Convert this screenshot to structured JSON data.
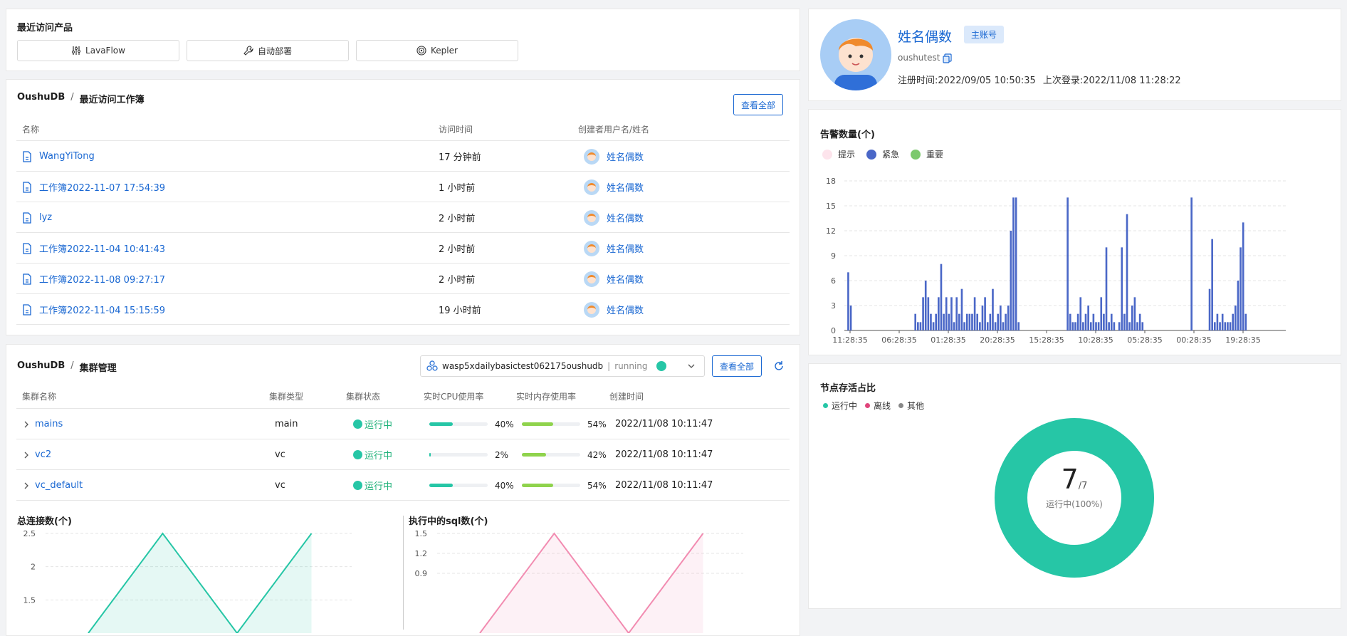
{
  "recent": {
    "title": "最近访问产品",
    "products": [
      {
        "label": "LavaFlow",
        "icon": "sliders-icon"
      },
      {
        "label": "自动部署",
        "icon": "wrench-icon"
      },
      {
        "label": "Kepler",
        "icon": "spiral-icon"
      }
    ]
  },
  "workbooks": {
    "crumb_root": "OushuDB",
    "crumb_sep": "/",
    "crumb_page": "最近访问工作簿",
    "view_all": "查看全部",
    "headers": [
      "名称",
      "访问时间",
      "创建者用户名/姓名"
    ],
    "rows": [
      {
        "name": "WangYiTong",
        "time": "17 分钟前",
        "creator": "姓名偶数"
      },
      {
        "name": "工作簿2022-11-07 17:54:39",
        "time": "1 小时前",
        "creator": "姓名偶数"
      },
      {
        "name": "lyz",
        "time": "2 小时前",
        "creator": "姓名偶数"
      },
      {
        "name": "工作簿2022-11-04 10:41:43",
        "time": "2 小时前",
        "creator": "姓名偶数"
      },
      {
        "name": "工作簿2022-11-08 09:27:17",
        "time": "2 小时前",
        "creator": "姓名偶数"
      },
      {
        "name": "工作簿2022-11-04 15:15:59",
        "time": "19 小时前",
        "creator": "姓名偶数"
      }
    ]
  },
  "cluster": {
    "crumb_root": "OushuDB",
    "crumb_sep": "/",
    "crumb_page": "集群管理",
    "selector_name": "wasp5xdailybasictest062175oushudb",
    "selector_sep": "|",
    "selector_status": "running",
    "view_all": "查看全部",
    "headers": [
      "集群名称",
      "集群类型",
      "集群状态",
      "实时CPU使用率",
      "实时内存使用率",
      "创建时间"
    ],
    "rows": [
      {
        "name": "mains",
        "type": "main",
        "status": "运行中",
        "cpu": 40,
        "cpu_label": "40%",
        "mem": 54,
        "mem_label": "54%",
        "created": "2022/11/08 10:11:47"
      },
      {
        "name": "vc2",
        "type": "vc",
        "status": "运行中",
        "cpu": 2,
        "cpu_label": "2%",
        "mem": 42,
        "mem_label": "42%",
        "created": "2022/11/08 10:11:47"
      },
      {
        "name": "vc_default",
        "type": "vc",
        "status": "运行中",
        "cpu": 40,
        "cpu_label": "40%",
        "mem": 54,
        "mem_label": "54%",
        "created": "2022/11/08 10:11:47"
      }
    ]
  },
  "profile": {
    "name": "姓名偶数",
    "badge": "主账号",
    "username": "oushutest",
    "register": "注册时间:2022/09/05 10:50:35",
    "last_login": "上次登录:2022/11/08 11:28:22"
  },
  "colors": {
    "accent": "#1967d2",
    "teal": "#26c6a6",
    "pink": "#f28cb1",
    "bar_blue": "#4a67c7",
    "green": "#7cc96d"
  },
  "chart_data": [
    {
      "type": "bar",
      "title": "告警数量(个)",
      "legend": [
        {
          "name": "提示",
          "color": "#fde4ec"
        },
        {
          "name": "紧急",
          "color": "#4a67c7"
        },
        {
          "name": "重要",
          "color": "#7cc96d"
        }
      ],
      "yticks": [
        "0",
        "3",
        "6",
        "9",
        "12",
        "15",
        "18"
      ],
      "ylim": [
        0,
        18
      ],
      "xticks": [
        "11:28:35",
        "06:28:35",
        "01:28:35",
        "20:28:35",
        "15:28:35",
        "10:28:35",
        "05:28:35",
        "00:28:35",
        "19:28:35"
      ],
      "series": [
        {
          "name": "紧急",
          "values": [
            0,
            7,
            3,
            0,
            0,
            0,
            0,
            0,
            0,
            0,
            0,
            0,
            0,
            0,
            0,
            0,
            0,
            0,
            0,
            0,
            0,
            0,
            0,
            0,
            0,
            0,
            0,
            2,
            1,
            1,
            4,
            6,
            4,
            2,
            1,
            2,
            4,
            8,
            2,
            4,
            2,
            4,
            1,
            4,
            2,
            5,
            1,
            2,
            2,
            2,
            4,
            2,
            1,
            3,
            4,
            1,
            2,
            5,
            1,
            2,
            3,
            1,
            2,
            3,
            12,
            16,
            16,
            1,
            0,
            0,
            0,
            0,
            0,
            0,
            0,
            0,
            0,
            0,
            0,
            0,
            0,
            0,
            0,
            0,
            0,
            0,
            16,
            2,
            1,
            1,
            2,
            4,
            1,
            2,
            3,
            1,
            2,
            1,
            1,
            4,
            2,
            10,
            1,
            2,
            1,
            0,
            1,
            10,
            2,
            14,
            1,
            3,
            4,
            1,
            2,
            1,
            0,
            0,
            0,
            0,
            0,
            0,
            0,
            0,
            0,
            0,
            0,
            0,
            0,
            0,
            0,
            0,
            0,
            0,
            16,
            0,
            0,
            0,
            0,
            0,
            0,
            5,
            11,
            1,
            2,
            1,
            2,
            1,
            1,
            1,
            2,
            3,
            6,
            10,
            13,
            2,
            0,
            0,
            0,
            0,
            0,
            0,
            0,
            0,
            0,
            0,
            0,
            0,
            0,
            0,
            0
          ]
        }
      ]
    },
    {
      "type": "pie",
      "title": "节点存活占比",
      "legend": [
        "运行中",
        "离线",
        "其他"
      ],
      "center_value": "7",
      "center_total": "/7",
      "center_label": "运行中(100%)",
      "values": [
        {
          "name": "运行中",
          "value": 7
        },
        {
          "name": "离线",
          "value": 0
        },
        {
          "name": "其他",
          "value": 0
        }
      ]
    },
    {
      "type": "area",
      "title": "总连接数(个)",
      "yticks": [
        "1.5",
        "2",
        "2.5"
      ],
      "values": [
        1,
        2.5,
        1,
        2.5
      ]
    },
    {
      "type": "area",
      "title": "执行中的sql数(个)",
      "yticks": [
        "0.9",
        "1.2",
        "1.5"
      ],
      "values": [
        0,
        1.5,
        0,
        1.5
      ]
    }
  ]
}
